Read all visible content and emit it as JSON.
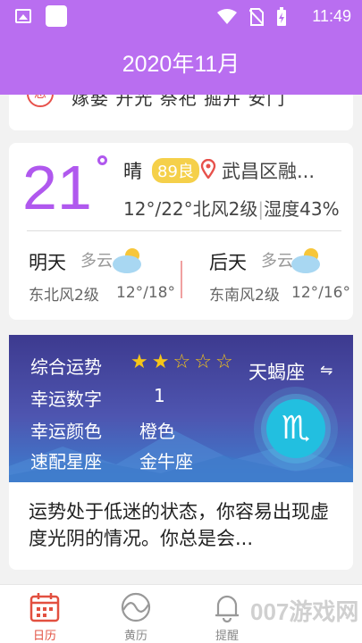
{
  "status_bar": {
    "time": "11:49",
    "icons": [
      "image-icon",
      "notification-square-icon",
      "wifi-icon",
      "no-sim-icon",
      "battery-charging-icon"
    ]
  },
  "header": {
    "title": "2020年11月"
  },
  "partial_card": {
    "badge": "忌",
    "text": "嫁娶 开光 祭祀 掘井 安门"
  },
  "weather": {
    "temperature": "21",
    "condition": "晴",
    "aqi": "89良",
    "location": "武昌区融...",
    "temp_range": "12°/22°",
    "wind": "北风2级",
    "humidity": "湿度43%",
    "tomorrow": {
      "label": "明天",
      "condition": "多云",
      "wind": "东北风2级",
      "temp": "12°/18°"
    },
    "day_after": {
      "label": "后天",
      "condition": "多云",
      "wind": "东南风2级",
      "temp": "12°/16°"
    }
  },
  "horoscope": {
    "rows": [
      {
        "label": "综合运势"
      },
      {
        "label": "幸运数字",
        "value": "1"
      },
      {
        "label": "幸运颜色",
        "value": "橙色"
      },
      {
        "label": "速配星座",
        "value": "金牛座"
      }
    ],
    "rating": 2,
    "rating_max": 5,
    "sign_name": "天蝎座",
    "sign_symbol": "♏",
    "fortune": "运势处于低迷的状态，你容易出现虚度光阴的情况。你总是会..."
  },
  "bottom_nav": [
    {
      "label": "日历",
      "icon": "calendar-icon",
      "active": true
    },
    {
      "label": "黄历",
      "icon": "almanac-icon",
      "active": false
    },
    {
      "label": "提醒",
      "icon": "bell-icon",
      "active": false
    }
  ],
  "watermark": "007游戏网",
  "colors": {
    "brand": "#b96ef0",
    "temp": "#b058ee",
    "aqi": "#f5d04a",
    "active_nav": "#e25040"
  }
}
